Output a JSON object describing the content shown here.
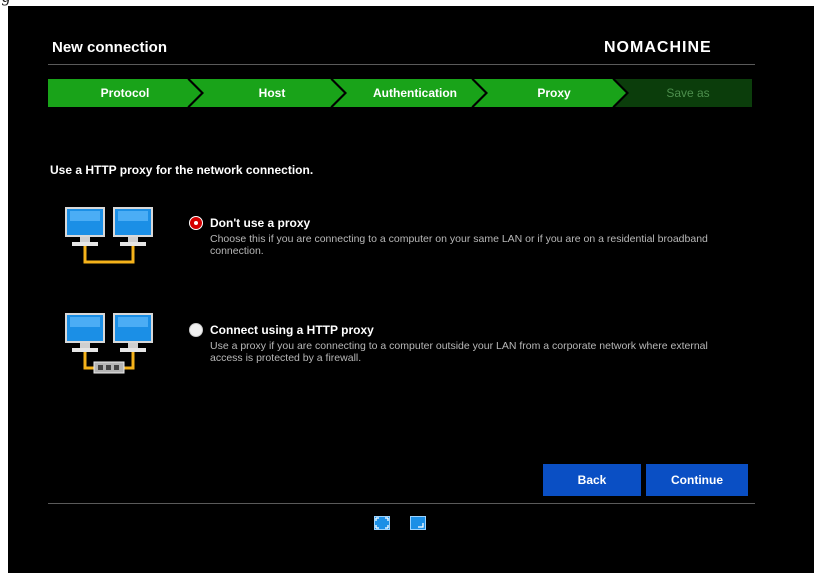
{
  "window": {
    "title": "New connection",
    "brand": "NOMACHINE"
  },
  "steps": [
    {
      "label": "Protocol",
      "state": "done"
    },
    {
      "label": "Host",
      "state": "done"
    },
    {
      "label": "Authentication",
      "state": "done"
    },
    {
      "label": "Proxy",
      "state": "current"
    },
    {
      "label": "Save as",
      "state": "todo"
    }
  ],
  "colors": {
    "step_active": "#19a319",
    "step_inactive": "#0b3d0b",
    "button": "#0a4fc4",
    "radio_selected": "#d40000",
    "cable": "#f5b21a"
  },
  "intro_text": "Use a HTTP proxy for the network connection.",
  "options": [
    {
      "title": "Don't use a proxy",
      "description": "Choose this if you are connecting to a computer on your same LAN or if you are on a residential broadband connection.",
      "selected": true,
      "icon": "two-monitors-direct-link-icon"
    },
    {
      "title": "Connect using a HTTP proxy",
      "description": "Use a proxy if you are connecting to a computer outside your LAN from a corporate network where external access is protected by a firewall.",
      "selected": false,
      "icon": "two-monitors-proxy-link-icon"
    }
  ],
  "buttons": {
    "back": "Back",
    "continue": "Continue"
  },
  "footer_icons": [
    "fullscreen-icon",
    "window-resize-icon"
  ]
}
